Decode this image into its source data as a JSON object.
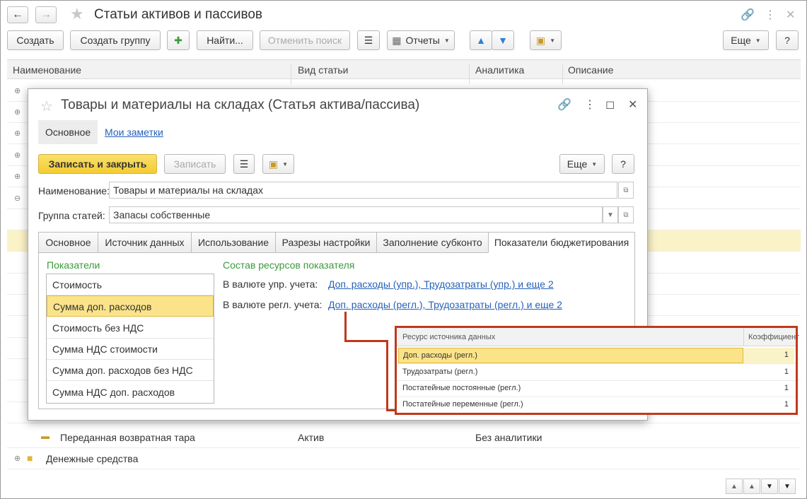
{
  "window": {
    "title": "Статьи активов и пассивов"
  },
  "toolbar": {
    "create": "Создать",
    "create_group": "Создать группу",
    "find": "Найти...",
    "cancel_search": "Отменить поиск",
    "reports": "Отчеты",
    "more": "Еще",
    "help": "?"
  },
  "grid": {
    "columns": [
      "Наименование",
      "Вид статьи",
      "Аналитика",
      "Описание"
    ],
    "rows": [
      {
        "name": "Переданная возвратная тара",
        "type": "Актив",
        "analytics": "Без аналитики"
      },
      {
        "name": "Денежные средства",
        "type": "",
        "analytics": ""
      }
    ]
  },
  "dialog": {
    "title": "Товары и материалы на складах (Статья актива/пассива)",
    "subtabs": [
      "Основное",
      "Мои заметки"
    ],
    "save_close": "Записать и закрыть",
    "save": "Записать",
    "more": "Еще",
    "help": "?",
    "name_label": "Наименование:",
    "name_value": "Товары и материалы на складах",
    "group_label": "Группа статей:",
    "group_value": "Запасы собственные",
    "tabs": [
      "Основное",
      "Источник данных",
      "Использование",
      "Разрезы настройки",
      "Заполнение субконто",
      "Показатели бюджетирования"
    ],
    "indicators_title": "Показатели",
    "indicators": [
      "Стоимость",
      "Сумма доп. расходов",
      "Стоимость без НДС",
      "Сумма НДС стоимости",
      "Сумма доп. расходов без НДС",
      "Сумма НДС доп. расходов"
    ],
    "resources_title": "Состав ресурсов показателя",
    "mgmt_label": "В валюте упр. учета:",
    "mgmt_link": "Доп. расходы (упр.), Трудозатраты (упр.) и еще 2",
    "reg_label": "В валюте регл. учета:",
    "reg_link": "Доп. расходы (регл.), Трудозатраты (регл.) и еще 2"
  },
  "callout": {
    "columns": [
      "Ресурс источника данных",
      "Коэффициент"
    ],
    "rows": [
      {
        "resource": "Доп. расходы (регл.)",
        "coef": "1"
      },
      {
        "resource": "Трудозатраты (регл.)",
        "coef": "1"
      },
      {
        "resource": "Постатейные постоянные (регл.)",
        "coef": "1"
      },
      {
        "resource": "Постатейные переменные (регл.)",
        "coef": "1"
      }
    ]
  },
  "colors": {
    "accent_yellow": "#f3cb33",
    "selection": "#fbe38a",
    "link": "#2561b8",
    "callout_border": "#c0391c",
    "section_green": "#3a9a3a"
  }
}
